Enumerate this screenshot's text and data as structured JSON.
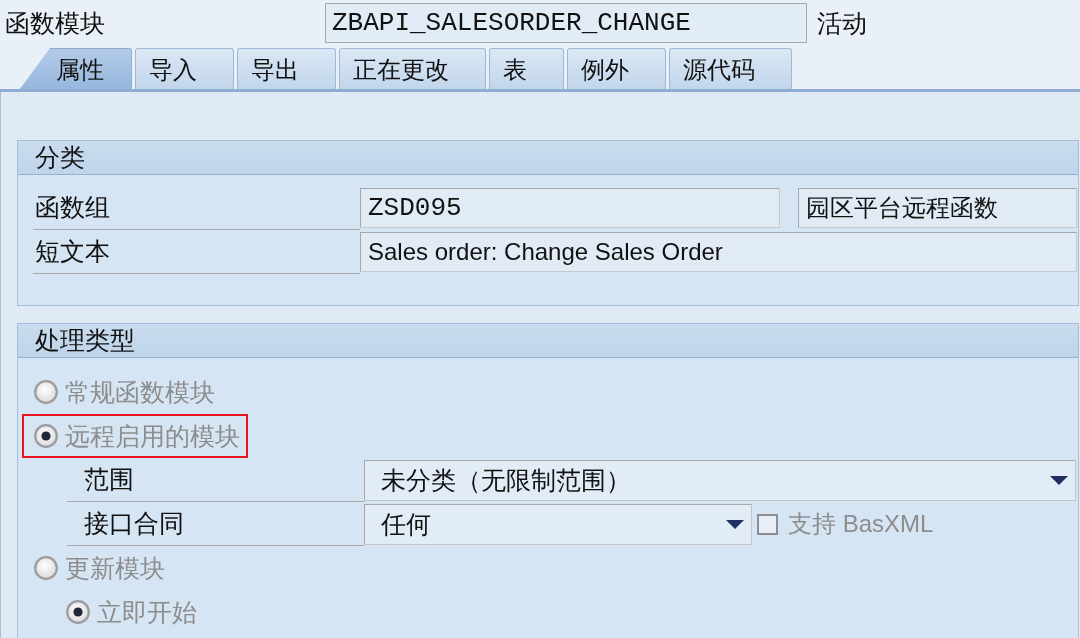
{
  "header": {
    "label": "函数模块",
    "value": "ZBAPI_SALESORDER_CHANGE",
    "status": "活动"
  },
  "tabs": [
    {
      "label": "属性",
      "selected": true
    },
    {
      "label": "导入",
      "selected": false
    },
    {
      "label": "导出",
      "selected": false
    },
    {
      "label": "正在更改",
      "selected": false
    },
    {
      "label": "表",
      "selected": false
    },
    {
      "label": "例外",
      "selected": false
    },
    {
      "label": "源代码",
      "selected": false
    }
  ],
  "classification": {
    "title": "分类",
    "rows": [
      {
        "label": "函数组",
        "fields": [
          {
            "kind": "code",
            "value": "ZSD095"
          },
          {
            "kind": "text",
            "value": "园区平台远程函数"
          }
        ]
      },
      {
        "label": "短文本",
        "fields": [
          {
            "kind": "text",
            "value": "Sales order: Change Sales Order"
          }
        ]
      }
    ]
  },
  "processing_type": {
    "title": "处理类型",
    "options": [
      {
        "kind": "radio",
        "label": "常规函数模块",
        "selected": false,
        "disabled": true
      },
      {
        "kind": "radio",
        "label": "远程启用的模块",
        "selected": true,
        "disabled": true,
        "highlighted": true,
        "children": [
          {
            "kind": "dropdown",
            "label": "范围",
            "value": "未分类（无限制范围）"
          },
          {
            "kind": "dropdown",
            "label": "接口合同",
            "value": "任何",
            "checkbox": {
              "label": "支持 BasXML",
              "checked": false,
              "disabled": true
            }
          }
        ]
      },
      {
        "kind": "radio",
        "label": "更新模块",
        "selected": false,
        "disabled": true,
        "children": [
          {
            "kind": "radio",
            "label": "立即开始",
            "selected": true,
            "disabled": true
          }
        ]
      }
    ]
  }
}
